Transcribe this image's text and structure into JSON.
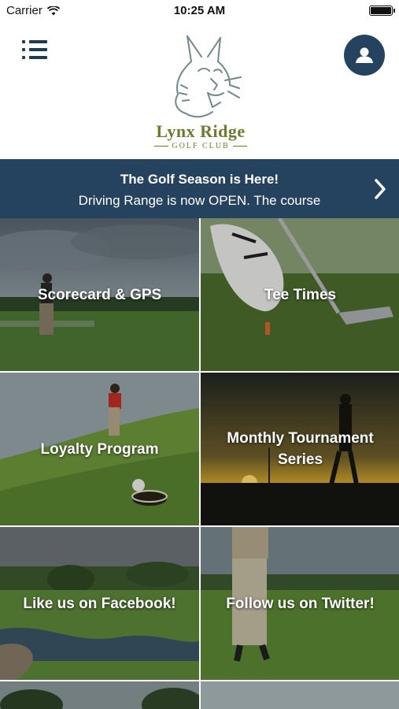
{
  "status_bar": {
    "carrier": "Carrier",
    "time": "10:25 AM"
  },
  "header": {
    "brand_name": "Lynx Ridge",
    "brand_sub": "GOLF CLUB"
  },
  "banner": {
    "title": "The Golf Season is Here!",
    "body": "Driving Range is now OPEN. The course"
  },
  "tiles": [
    {
      "label": "Scorecard & GPS"
    },
    {
      "label": "Tee Times"
    },
    {
      "label": "Loyalty Program"
    },
    {
      "label": "Monthly Tournament Series"
    },
    {
      "label": "Like us on Facebook!"
    },
    {
      "label": "Follow us on Twitter!"
    }
  ],
  "colors": {
    "navy": "#25425f",
    "brand_olive": "#6e7b2f"
  }
}
